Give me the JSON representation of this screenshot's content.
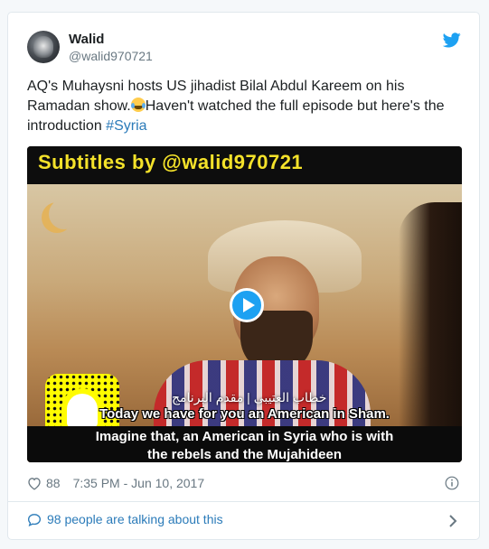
{
  "author": {
    "name": "Walid",
    "handle": "@walid970721"
  },
  "tweet": {
    "text_before_emoji": "AQ's Muhaysni hosts US jihadist Bilal Abdul Kareem on his Ramadan show.",
    "emoji_name": "face-with-tears-of-joy",
    "text_after_emoji": "Haven't watched the full episode but here's the introduction ",
    "hashtag": "#Syria"
  },
  "media": {
    "banner_text": "Subtitles by @walid970721",
    "arabic_caption": "خطاب العتيبي | مقدم البرنامج",
    "subtitle_line1": "Today we have for you an American in Sham.",
    "subtitle_line2": "Imagine that, an American in Syria who is with",
    "subtitle_line3": "the rebels and the Mujahideen",
    "play_icon": "play-icon"
  },
  "meta": {
    "likes": "88",
    "timestamp": "7:35 PM - Jun 10, 2017"
  },
  "footer": {
    "talking_text": "98 people are talking about this"
  },
  "colors": {
    "link": "#2b7bb9",
    "twitter_blue": "#1da1f2",
    "banner_yellow": "#f4e22a",
    "muted": "#697882"
  }
}
